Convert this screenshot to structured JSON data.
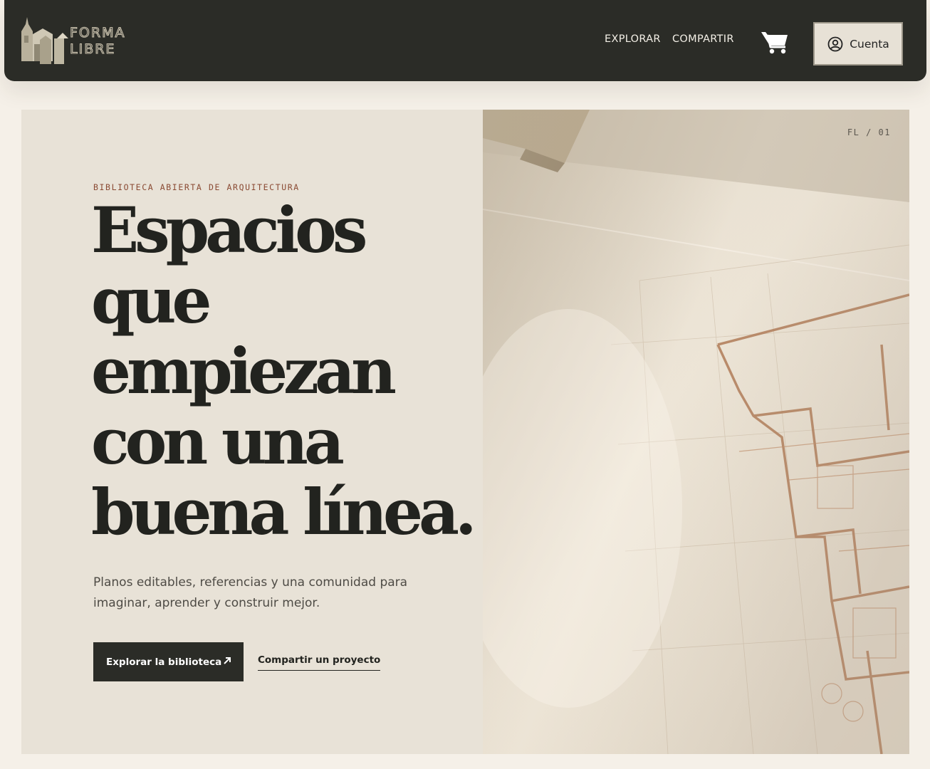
{
  "brand": {
    "name_line1": "FORMA",
    "name_line2": "LIBRE",
    "logo_color": "#c9c1ad"
  },
  "nav": {
    "items": [
      {
        "label": "EXPLORAR"
      },
      {
        "label": "COMPARTIR"
      }
    ],
    "cart_icon": "shopping-cart-icon",
    "account": {
      "label": "Cuenta",
      "icon": "user-circle-icon"
    }
  },
  "hero": {
    "eyebrow": "BIBLIOTECA ABIERTA DE ARQUITECTURA",
    "headline_lines": [
      "Espacios",
      "que",
      "empiezan",
      "con una",
      "buena línea."
    ],
    "subtext": "Planos editables, referencias y una comunidad para imaginar, aprender y construir mejor.",
    "primary_cta": {
      "label": "Explorar la biblioteca",
      "icon": "arrow-up-right-icon"
    },
    "secondary_cta": {
      "label": "Compartir un proyecto"
    },
    "image_tag": "FL / 01"
  },
  "colors": {
    "header_bg": "#2b2c27",
    "page_bg": "#f5f0e8",
    "hero_bg": "#e8e2d7",
    "accent": "#8a4a33",
    "text_dark": "#22231f"
  }
}
